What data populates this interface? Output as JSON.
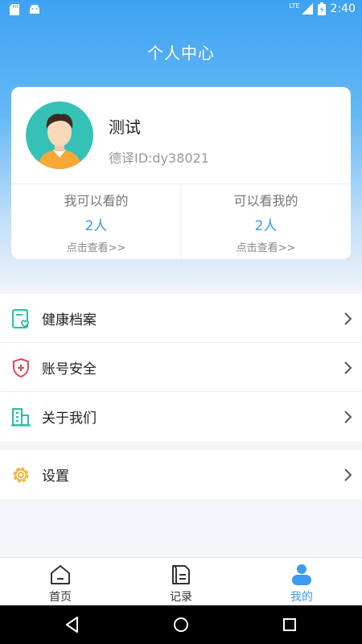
{
  "status_bar": {
    "time": "2:40",
    "network": "LTE",
    "icons": [
      "sd-card-icon",
      "android-icon",
      "signal-icon",
      "battery-charging-icon"
    ]
  },
  "header": {
    "title": "个人中心"
  },
  "profile": {
    "name": "测试",
    "id_text": "德译ID:dy38021",
    "stats": [
      {
        "label": "我可以看的",
        "count": "2人",
        "link": "点击查看>>"
      },
      {
        "label": "可以看我的",
        "count": "2人",
        "link": "点击查看>>"
      }
    ]
  },
  "menu": {
    "group1": [
      {
        "label": "健康档案",
        "icon": "health-record-icon"
      },
      {
        "label": "账号安全",
        "icon": "shield-plus-icon"
      },
      {
        "label": "关于我们",
        "icon": "building-icon"
      }
    ],
    "group2": [
      {
        "label": "设置",
        "icon": "gear-icon"
      }
    ]
  },
  "bottom_nav": {
    "items": [
      {
        "label": "首页",
        "icon": "home-icon"
      },
      {
        "label": "记录",
        "icon": "document-icon"
      },
      {
        "label": "我的",
        "icon": "person-icon"
      }
    ],
    "active_index": 2
  },
  "colors": {
    "accent": "#3c9bef",
    "header_gradient_top": "#3ea2f2",
    "health_icon": "#2bbfa0",
    "security_icon": "#e8455a",
    "about_icon": "#2bbfa0",
    "settings_icon": "#f0b43a"
  }
}
